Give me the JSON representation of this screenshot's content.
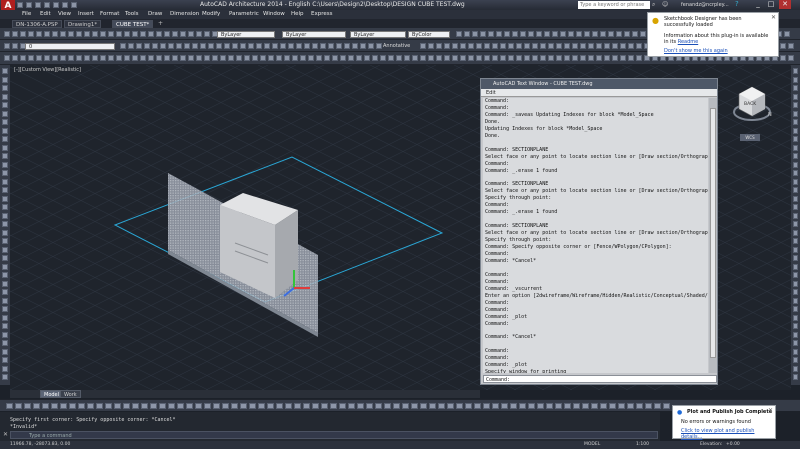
{
  "app": {
    "logo_text": "A",
    "window_title": "AutoCAD Architecture 2014 - English C:\\Users\\Design2\\Desktop\\DESIGN CUBE TEST.dwg",
    "search_placeholder": "Type a keyword or phrase",
    "signin_text": "fenandz@ncrpley...",
    "window_buttons": [
      "_",
      "□",
      "✕"
    ]
  },
  "menu": {
    "items": [
      "File",
      "Edit",
      "View",
      "Insert",
      "Format",
      "Tools",
      "Draw",
      "Dimension",
      "Modify",
      "Parametric",
      "Window",
      "Help",
      "Express"
    ]
  },
  "doc_tabs": [
    {
      "label": "DN-1306-A.PSP",
      "active": false
    },
    {
      "label": "Drawing1*",
      "active": false
    },
    {
      "label": "CUBE TEST*",
      "active": true
    }
  ],
  "toolbar": {
    "layer_combo": "0",
    "color_combo": "ByLayer",
    "linetype_combo": "ByLayer",
    "lineweight_combo": "ByLayer",
    "plotstyle_combo": "ByColor",
    "annotative_label": "Annotative",
    "standard_combo": "Standard",
    "scale_combo": "1:1"
  },
  "viewport": {
    "label": "[-][Custom View][Realistic]"
  },
  "viewcube": {
    "face_label": "BACK",
    "compass": "WCS",
    "top_mark": "N"
  },
  "text_window": {
    "title": "AutoCAD Text Window - CUBE TEST.dwg",
    "menu_edit": "Edit",
    "command_prompt": "Command:",
    "lines": [
      "Command:",
      "Command:",
      "Command: _saveas Updating Indexes for block *Model_Space",
      "Done.",
      "Updating Indexes for block *Model_Space",
      "Done.",
      "",
      "Command: SECTIONPLANE",
      "Select face or any point to locate section line or [Draw section/Orthographic",
      "Command:",
      "Command: _.erase 1 found",
      "",
      "Command: SECTIONPLANE",
      "Select face or any point to locate section line or [Draw section/Orthographic",
      "Specify through point:",
      "Command:",
      "Command: _.erase 1 found",
      "",
      "Command: SECTIONPLANE",
      "Select face or any point to locate section line or [Draw section/Orthographic",
      "Specify through point:",
      "Command: Specify opposite corner or [Fence/WPolygon/CPolygon]:",
      "Command:",
      "Command: *Cancel*",
      "",
      "Command:",
      "Command:",
      "Command: _vscurrent",
      "Enter an option [2dwireframe/Wireframe/Hidden/Realistic/Conceptual/Shaded/sha",
      "Command:",
      "Command:",
      "Command: _plot",
      "Command:",
      "",
      "Command: *Cancel*",
      "",
      "Command:",
      "Command:",
      "Command: _plot",
      "Specify window for printing",
      "Specify first corner: Specify opposite corner: *Cancel*",
      "*Invalid*"
    ]
  },
  "layout_tabs": [
    {
      "label": "Model",
      "active": true
    },
    {
      "label": "Work",
      "active": false
    }
  ],
  "command_line": {
    "history": [
      "Specify first corner: Specify opposite corner: *Cancel*",
      "*Invalid*"
    ],
    "placeholder": "Type a command"
  },
  "status_bar": {
    "coords": "11966.78, -28073.83, 0.00",
    "model_label": "MODEL",
    "scale": "1:100",
    "elevation_label": "Elevation:",
    "elevation_value": "+0.00"
  },
  "plugin_balloon": {
    "title": "Sketchbook Designer has been successfully loaded",
    "text": "Information about this plug-in is available in its",
    "link_inline": "Readme",
    "link": "Don't show me this again"
  },
  "publish_balloon": {
    "title": "Plot and Publish Job Complete",
    "text": "No errors or warnings found",
    "link": "Click to view plot and publish details..."
  },
  "colors": {
    "background": "#1f242c",
    "section_plane": "#2aa7d6",
    "logo": "#b01e1e",
    "link": "#1a4fb8"
  }
}
